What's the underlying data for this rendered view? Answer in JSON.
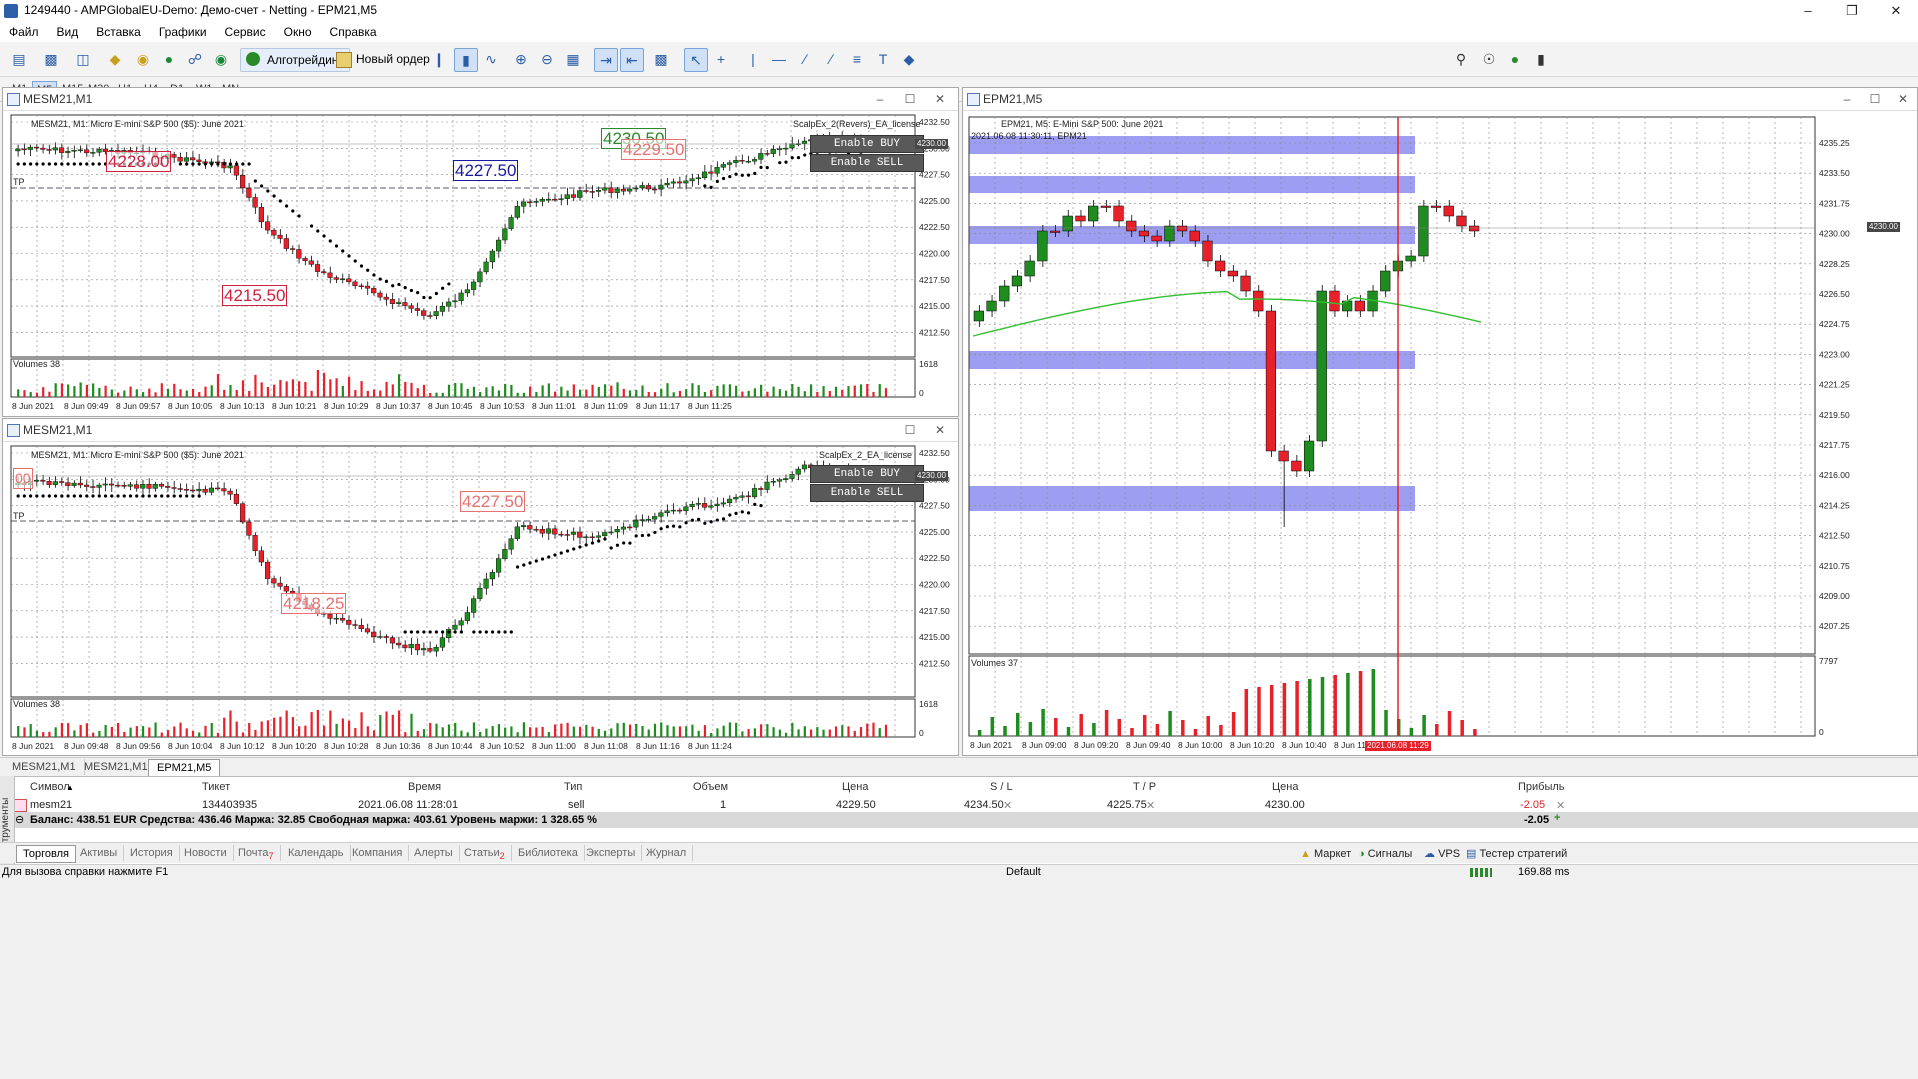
{
  "window": {
    "title": "1249440 - AMPGlobalEU-Demo: Демо-счет - Netting - EPM21,M5"
  },
  "menu": [
    "Файл",
    "Вид",
    "Вставка",
    "Графики",
    "Сервис",
    "Окно",
    "Справка"
  ],
  "toolbar": {
    "algotrading": "Алготрейдинг",
    "new_order": "Новый ордер"
  },
  "timeframes": [
    "M1",
    "M5",
    "M15",
    "M30",
    "H1",
    "H4",
    "D1",
    "W1",
    "MN"
  ],
  "active_timeframe": "M5",
  "charts": {
    "c1": {
      "title": "MESM21,M1",
      "info": "MESM21, M1:  Micro E-mini S&P 500 ($5): June 2021",
      "ea": "ScalpEx_2(Revers)_EA_license",
      "btn_buy": "Enable BUY",
      "btn_sell": "Enable SELL",
      "volumes": "Volumes 38",
      "tp": "TP",
      "price_tag": "4230.00",
      "labels": [
        "4228.00",
        "4227.50",
        "4215.50",
        "4230.50",
        "4229.50"
      ],
      "levels": [
        "4232.50",
        "4230.00",
        "4227.50",
        "4225.00",
        "4222.50",
        "4220.00",
        "4217.50",
        "4215.00",
        "4212.50"
      ],
      "vol_levels": [
        "1618",
        "0"
      ],
      "times": [
        "8 Jun 2021",
        "8 Jun 09:49",
        "8 Jun 09:57",
        "8 Jun 10:05",
        "8 Jun 10:13",
        "8 Jun 10:21",
        "8 Jun 10:29",
        "8 Jun 10:37",
        "8 Jun 10:45",
        "8 Jun 10:53",
        "8 Jun 11:01",
        "8 Jun 11:09",
        "8 Jun 11:17",
        "8 Jun 11:25"
      ]
    },
    "c2": {
      "title": "MESM21,M1",
      "info": "MESM21, M1:  Micro E-mini S&P 500 ($5): June 2021",
      "ea": "ScalpEx_2_EA_license",
      "btn_buy": "Enable BUY",
      "btn_sell": "Enable SELL",
      "volumes": "Volumes 38",
      "tp": "TP",
      "price_tag": "4230.00",
      "labels": [
        "4227.50",
        "4218.25",
        "00"
      ],
      "levels": [
        "4232.50",
        "4230.00",
        "4227.50",
        "4225.00",
        "4222.50",
        "4220.00",
        "4217.50",
        "4215.00",
        "4212.50"
      ],
      "vol_levels": [
        "1618",
        "0"
      ],
      "times": [
        "8 Jun 2021",
        "8 Jun 09:48",
        "8 Jun 09:56",
        "8 Jun 10:04",
        "8 Jun 10:12",
        "8 Jun 10:20",
        "8 Jun 10:28",
        "8 Jun 10:36",
        "8 Jun 10:44",
        "8 Jun 10:52",
        "8 Jun 11:00",
        "8 Jun 11:08",
        "8 Jun 11:16",
        "8 Jun 11:24"
      ]
    },
    "c3": {
      "title": "EPM21,M5",
      "info": "EPM21, M5:  E-Mini S&P 500: June 2021",
      "info2": "2021.06.08 11:30:11, EPM21",
      "volumes": "Volumes 37",
      "price_tag": "4230.00",
      "levels": [
        "4235.25",
        "4233.50",
        "4231.75",
        "4230.00",
        "4228.25",
        "4226.50",
        "4224.75",
        "4223.00",
        "4221.25",
        "4219.50",
        "4217.75",
        "4216.00",
        "4214.25",
        "4212.50",
        "4210.75",
        "4209.00",
        "4207.25"
      ],
      "vol_levels": [
        "7797",
        "0"
      ],
      "times": [
        "8 Jun 2021",
        "8 Jun 09:00",
        "8 Jun 09:20",
        "8 Jun 09:40",
        "8 Jun 10:00",
        "8 Jun 10:20",
        "8 Jun 10:40",
        "8 Jun 11:00"
      ],
      "cursor_time": "2021.06.08 11:29"
    }
  },
  "chart_tabs": [
    "MESM21,M1",
    "MESM21,M1",
    "EPM21,M5"
  ],
  "terminal": {
    "headers": {
      "symbol": "Символ",
      "ticket": "Тикет",
      "time": "Время",
      "type": "Тип",
      "volume": "Объем",
      "price": "Цена",
      "sl": "S / L",
      "tp": "T / P",
      "cur_price": "Цена",
      "profit": "Прибыль"
    },
    "row": {
      "symbol": "mesm21",
      "ticket": "134403935",
      "time": "2021.06.08 11:28:01",
      "type": "sell",
      "volume": "1",
      "price": "4229.50",
      "sl": "4234.50",
      "tp": "4225.75",
      "cur_price": "4230.00",
      "profit": "-2.05"
    },
    "balance": "Баланс: 438.51 EUR  Средства: 436.46  Маржа: 32.85  Свободная маржа: 403.61  Уровень маржи: 1 328.65 %",
    "total": "-2.05"
  },
  "bottom_tabs": [
    "Торговля",
    "Активы",
    "История",
    "Новости",
    "Почта",
    "Календарь",
    "Компания",
    "Алерты",
    "Статьи",
    "Библиотека",
    "Эксперты",
    "Журнал"
  ],
  "bottom_badges": {
    "mail": "7",
    "articles": "2"
  },
  "right_buttons": [
    "Маркет",
    "Сигналы",
    "VPS",
    "Тестер стратегий"
  ],
  "vertical_label": "Инструменты",
  "status": {
    "help": "Для вызова справки нажмите F1",
    "profile": "Default",
    "ping": "169.88 ms"
  },
  "colors": {
    "bull": "#1e8c1e",
    "bear": "#e8202a",
    "band": "#8c8cf0",
    "dots": "#000000",
    "price_tag": "#464646"
  }
}
